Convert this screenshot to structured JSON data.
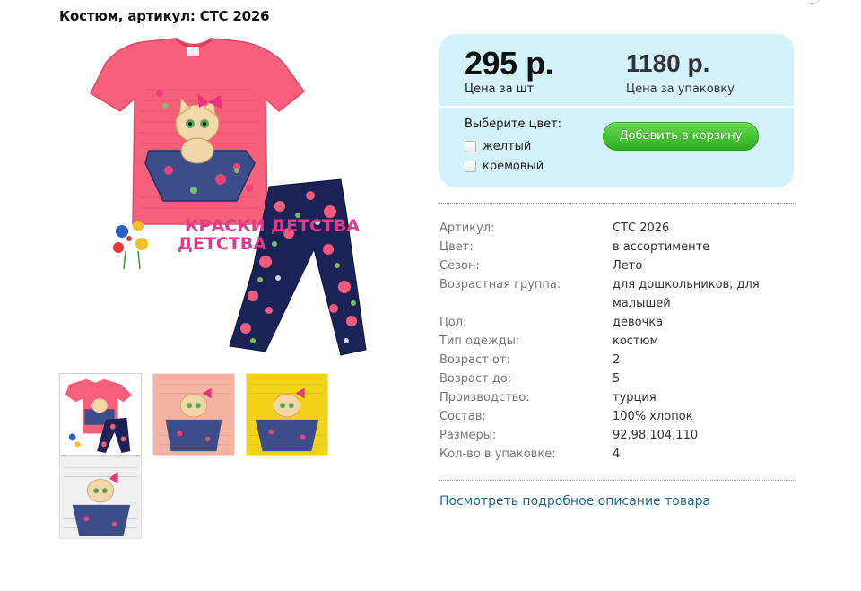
{
  "page": {
    "title": "Костюм, артикул: СТС 2026"
  },
  "gallery": {
    "thumbnails": [
      {
        "variant": "coral set"
      },
      {
        "variant": "peach shirt"
      },
      {
        "variant": "yellow shirt"
      },
      {
        "variant": "white shirt"
      }
    ],
    "brand_text": "КРАСКИ ДЕТСТВА"
  },
  "price": {
    "unit_value": "295 р.",
    "unit_caption": "Цена за шт",
    "pack_value": "1180 р.",
    "pack_caption": "Цена за упаковку"
  },
  "color_select": {
    "title": "Выберите цвет:",
    "options": [
      "желтый",
      "кремовый"
    ]
  },
  "cart_button": {
    "label": "Добавить в корзину"
  },
  "specs": [
    {
      "label": "Артикул:",
      "value": "СТС 2026"
    },
    {
      "label": "Цвет:",
      "value": "в ассортименте"
    },
    {
      "label": "Сезон:",
      "value": "Лето"
    },
    {
      "label": "Возрастная группа:",
      "value": "для дошкольников, для малышей"
    },
    {
      "label": "Пол:",
      "value": "девочка"
    },
    {
      "label": "Тип одежды:",
      "value": "костюм"
    },
    {
      "label": "Возраст от:",
      "value": "2"
    },
    {
      "label": "Возраст до:",
      "value": "5"
    },
    {
      "label": "Производство:",
      "value": "турция"
    },
    {
      "label": "Состав:",
      "value": "100% хлопок"
    },
    {
      "label": "Размеры:",
      "value": "92,98,104,110"
    },
    {
      "label": "Кол-во в упаковке:",
      "value": "4"
    }
  ],
  "more_link": {
    "label": "Посмотреть подробное описание товара"
  },
  "colors": {
    "price_box_bg": "#d3f2fb",
    "button_green": "#3fbf2c",
    "link_blue": "#1f6d97",
    "shirt_coral": "#f7607a",
    "leggings_navy": "#1b2356"
  }
}
